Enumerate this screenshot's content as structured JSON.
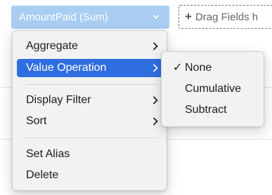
{
  "field_chip": {
    "label": "AmountPaid (Sum)",
    "caret_icon": "chevron-down-icon",
    "color": "#a9cdf3"
  },
  "drag_zone": {
    "plus": "+",
    "label": "Drag Fields h"
  },
  "menu": {
    "items": [
      {
        "label": "Aggregate",
        "has_submenu": true
      },
      {
        "label": "Value Operation",
        "has_submenu": true,
        "highlighted": true
      },
      {
        "label": "Display Filter",
        "has_submenu": true
      },
      {
        "label": "Sort",
        "has_submenu": true
      },
      {
        "label": "Set Alias",
        "has_submenu": false
      },
      {
        "label": "Delete",
        "has_submenu": false
      }
    ],
    "highlight_color": "#2f6ee0"
  },
  "submenu": {
    "check": "✓",
    "items": [
      {
        "label": "None",
        "checked": true
      },
      {
        "label": "Cumulative",
        "checked": false
      },
      {
        "label": "Subtract",
        "checked": false
      }
    ]
  }
}
